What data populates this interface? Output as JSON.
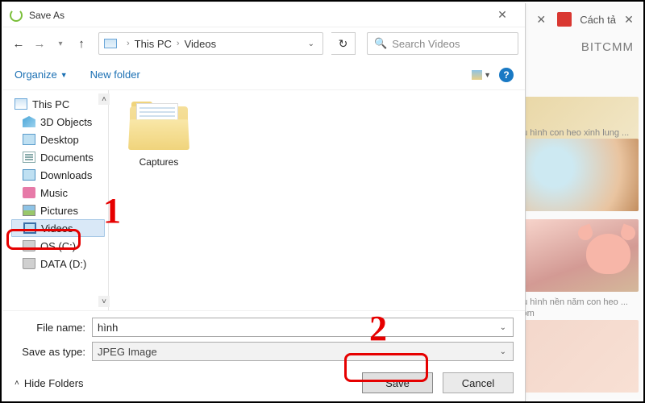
{
  "bg": {
    "tab_close": "✕",
    "tab_label": "Cách tả",
    "title_frag": "BITCMM",
    "thumb1_cap": "",
    "thumb2_cap": "hu hình con heo xinh lung ...",
    "thumb3_cap": "",
    "thumb4_cap": "ẩu hình nền năm con heo ...",
    "thumb4_sub": "com"
  },
  "dialog": {
    "title": "Save As",
    "close": "✕",
    "nav": {
      "back": "←",
      "fwd": "→",
      "up": "↑"
    },
    "path": {
      "root": "This PC",
      "folder": "Videos",
      "sep": "›"
    },
    "refresh": "↻",
    "search_placeholder": "Search Videos",
    "organize": "Organize",
    "newfolder": "New folder",
    "help": "?",
    "tree": {
      "thispc": "This PC",
      "obj3d": "3D Objects",
      "desktop": "Desktop",
      "documents": "Documents",
      "downloads": "Downloads",
      "music": "Music",
      "pictures": "Pictures",
      "videos": "Videos",
      "osc": "OS (C:)",
      "data": "DATA (D:)"
    },
    "content": {
      "folder1": "Captures"
    },
    "filename_label": "File name:",
    "filename_value": "hình",
    "savetype_label": "Save as type:",
    "savetype_value": "JPEG Image",
    "hide": "Hide Folders",
    "save": "Save",
    "cancel": "Cancel"
  },
  "annot": {
    "one": "1",
    "two": "2"
  }
}
